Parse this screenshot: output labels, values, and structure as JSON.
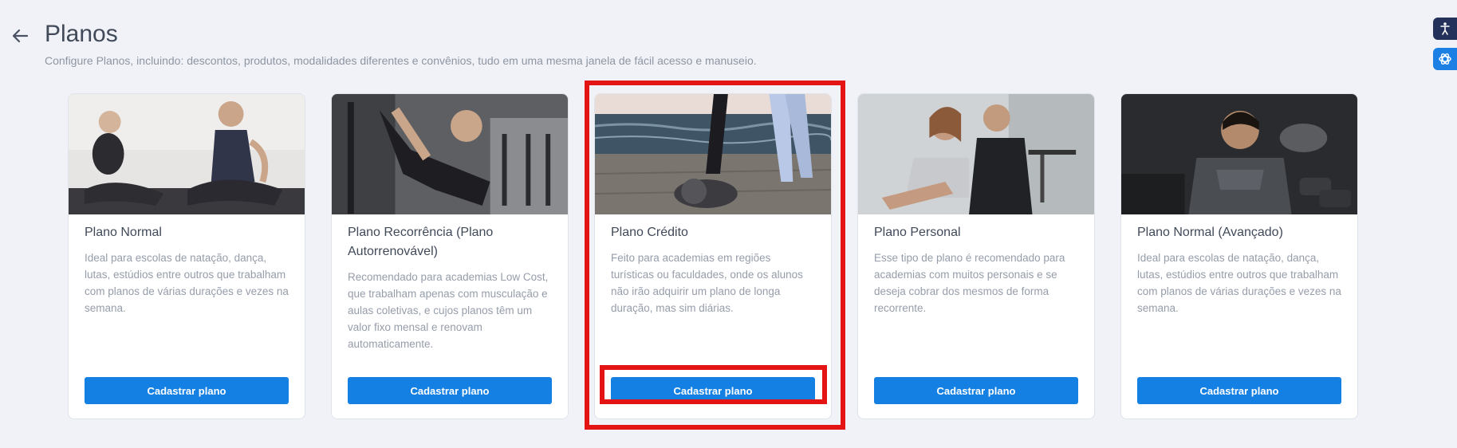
{
  "page": {
    "title": "Planos",
    "subtitle": "Configure Planos, incluindo: descontos, produtos, modalidades diferentes e convênios, tudo em uma mesma janela de fácil acesso e manuseio."
  },
  "icons": {
    "back": "arrow-left-icon",
    "side_top": "accessibility-icon",
    "side_bottom": "openai-icon"
  },
  "colors": {
    "accent": "#1580e3",
    "highlight": "#e41414",
    "background": "#f0f2f7"
  },
  "cards": [
    {
      "title": "Plano Normal",
      "description": "Ideal para escolas de natação, dança, lutas, estúdios entre outros que trabalham com planos de várias durações e vezes na semana.",
      "button": "Cadastrar plano"
    },
    {
      "title": "Plano Recorrência (Plano Autorrenovável)",
      "description": "Recomendado para academias Low Cost, que trabalham apenas com musculação e aulas coletivas, e cujos planos têm um valor fixo mensal e renovam automaticamente.",
      "button": "Cadastrar plano"
    },
    {
      "title": "Plano Crédito",
      "description": "Feito para academias em regiões turísticas ou faculdades, onde os alunos não irão adquirir um plano de longa duração, mas sim diárias.",
      "button": "Cadastrar plano"
    },
    {
      "title": "Plano Personal",
      "description": "Esse tipo de plano é recomendado para academias com muitos personais e se deseja cobrar dos mesmos de forma recorrente.",
      "button": "Cadastrar plano"
    },
    {
      "title": "Plano Normal (Avançado)",
      "description": "Ideal para escolas de natação, dança, lutas, estúdios entre outros que trabalham com planos de várias durações e vezes na semana.",
      "button": "Cadastrar plano"
    }
  ]
}
